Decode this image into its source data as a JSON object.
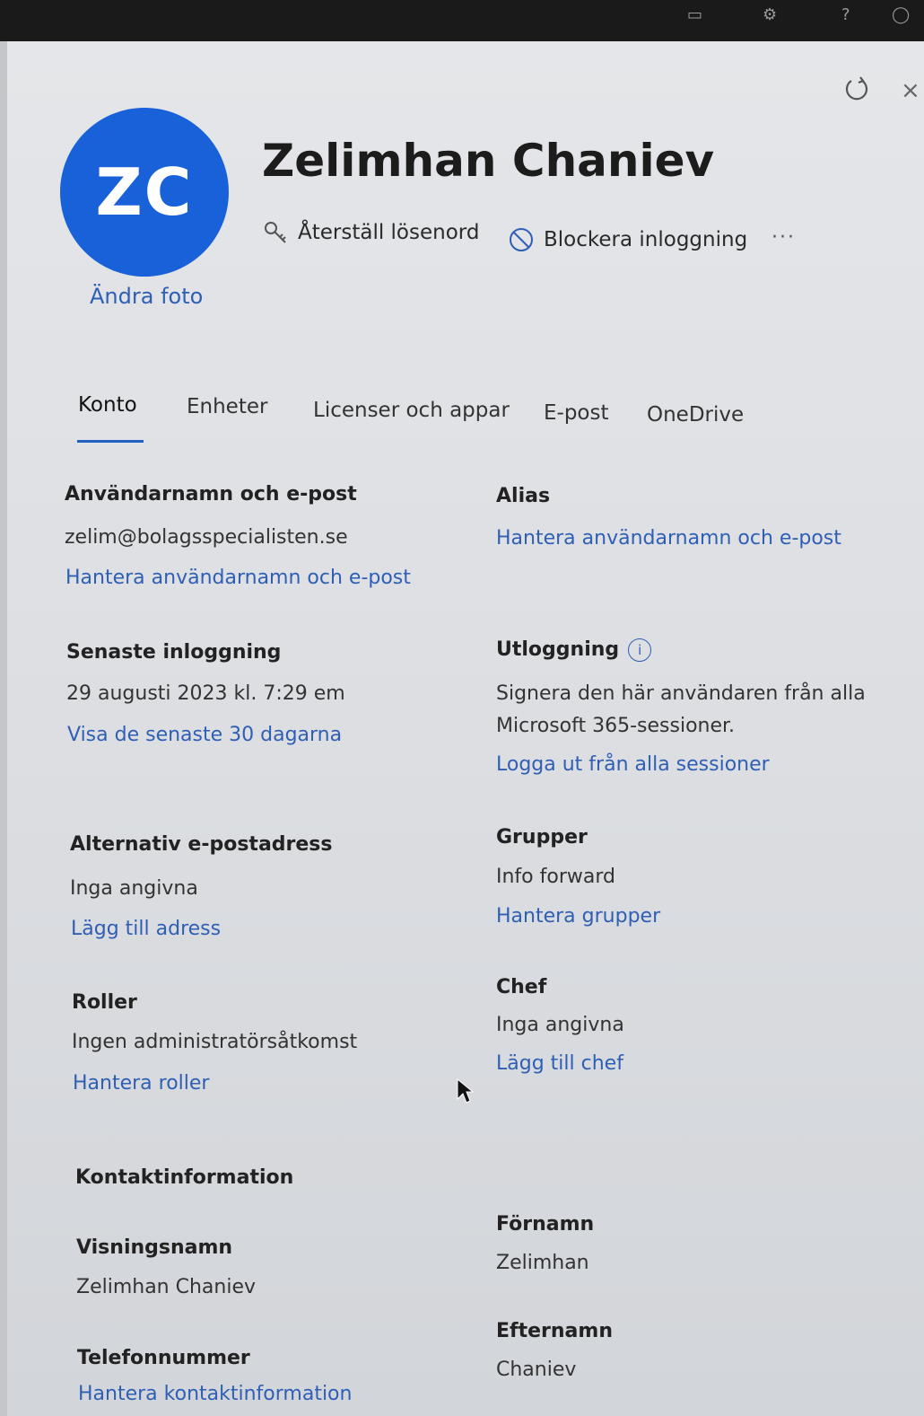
{
  "user": {
    "initials": "ZC",
    "name": "Zelimhan Chaniev",
    "change_photo": "Ändra foto"
  },
  "actions": {
    "reset_password": "Återställ lösenord",
    "block_signin": "Blockera inloggning",
    "more": "···"
  },
  "tabs": [
    {
      "label": "Konto",
      "active": true
    },
    {
      "label": "Enheter"
    },
    {
      "label": "Licenser och appar"
    },
    {
      "label": "E-post"
    },
    {
      "label": "OneDrive"
    }
  ],
  "account": {
    "username": {
      "label": "Användarnamn och e-post",
      "value": "zelim@bolagsspecialisten.se",
      "link": "Hantera användarnamn och e-post"
    },
    "alias": {
      "label": "Alias",
      "link": "Hantera användarnamn och e-post"
    },
    "last_signin": {
      "label": "Senaste inloggning",
      "value": "29 augusti 2023 kl. 7:29 em",
      "link": "Visa de senaste 30 dagarna"
    },
    "signout": {
      "label": "Utloggning",
      "info": "i",
      "value_line1": "Signera den här användaren från alla",
      "value_line2": "Microsoft 365-sessioner.",
      "link": "Logga ut från alla sessioner"
    },
    "alt_email": {
      "label": "Alternativ e-postadress",
      "value": "Inga angivna",
      "link": "Lägg till adress"
    },
    "groups": {
      "label": "Grupper",
      "value": "Info forward",
      "link": "Hantera grupper"
    },
    "roles": {
      "label": "Roller",
      "value": "Ingen administratörsåtkomst",
      "link": "Hantera roller"
    },
    "manager": {
      "label": "Chef",
      "value": "Inga angivna",
      "link": "Lägg till chef"
    }
  },
  "contact": {
    "heading": "Kontaktinformation",
    "display_name": {
      "label": "Visningsnamn",
      "value": "Zelimhan Chaniev"
    },
    "first_name": {
      "label": "Förnamn",
      "value": "Zelimhan"
    },
    "phone": {
      "label": "Telefonnummer"
    },
    "last_name": {
      "label": "Efternamn",
      "value": "Chaniev"
    },
    "manage_link": "Hantera kontaktinformation"
  },
  "colors": {
    "accent": "#2f5fb5",
    "avatar": "#1861d9",
    "topbar": "#1a1a1a"
  }
}
